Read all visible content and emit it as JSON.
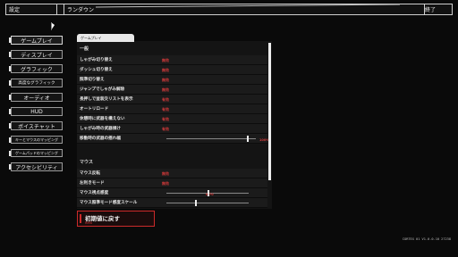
{
  "window": {
    "title": "設定",
    "breadcrumb": "ランダウン",
    "close_label": "終了"
  },
  "sidebar": {
    "items": [
      {
        "label": "ゲームプレイ"
      },
      {
        "label": "ディスプレイ"
      },
      {
        "label": "グラフィック"
      },
      {
        "label": "高度なグラフィック"
      },
      {
        "label": "オーディオ"
      },
      {
        "label": "HUD"
      },
      {
        "label": "ボイスチャット"
      },
      {
        "label": "キーとマウスのマッピング"
      },
      {
        "label": "ゲームパッドのマッピング"
      },
      {
        "label": "アクセシビリティ"
      }
    ]
  },
  "main": {
    "tab_label": "ゲームプレイ",
    "section_general": "一般",
    "general_rows": [
      {
        "label": "しゃがみ切り替え",
        "value": "無効"
      },
      {
        "label": "ダッシュ切り替え",
        "value": "無効"
      },
      {
        "label": "照準切り替え",
        "value": "無効"
      },
      {
        "label": "ジャンプでしゃがみ解除",
        "value": "無効"
      },
      {
        "label": "長押しで並装交リストを表示",
        "value": "有効"
      },
      {
        "label": "オートリロード",
        "value": "有効"
      },
      {
        "label": "休憩時に武器を構えない",
        "value": "有効"
      },
      {
        "label": "しゃがみ時の武器傾け",
        "value": "有効"
      }
    ],
    "sway_row": {
      "label": "移動時の武器の揺れ幅",
      "value": "100%",
      "level": 0.9
    },
    "section_mouse": "マウス",
    "mouse_rows": [
      {
        "label": "マウス反転",
        "value": "無効"
      },
      {
        "label": "左利きモード",
        "value": "無効"
      }
    ],
    "sensitivity_row": {
      "label": "マウス視点感度",
      "value": "0.70",
      "level": 0.5
    },
    "ads_row": {
      "label": "マウス照準モード感度スケール",
      "level": 0.35
    }
  },
  "reset": {
    "label": "初期値に戻す",
    "sub": "RMB"
  },
  "footer": {
    "version": "CORTEX 01 V1.0.0.10 27238"
  },
  "colors": {
    "accent": "#cc2a2a",
    "panel": "#141414",
    "background": "#0a0a0a"
  }
}
